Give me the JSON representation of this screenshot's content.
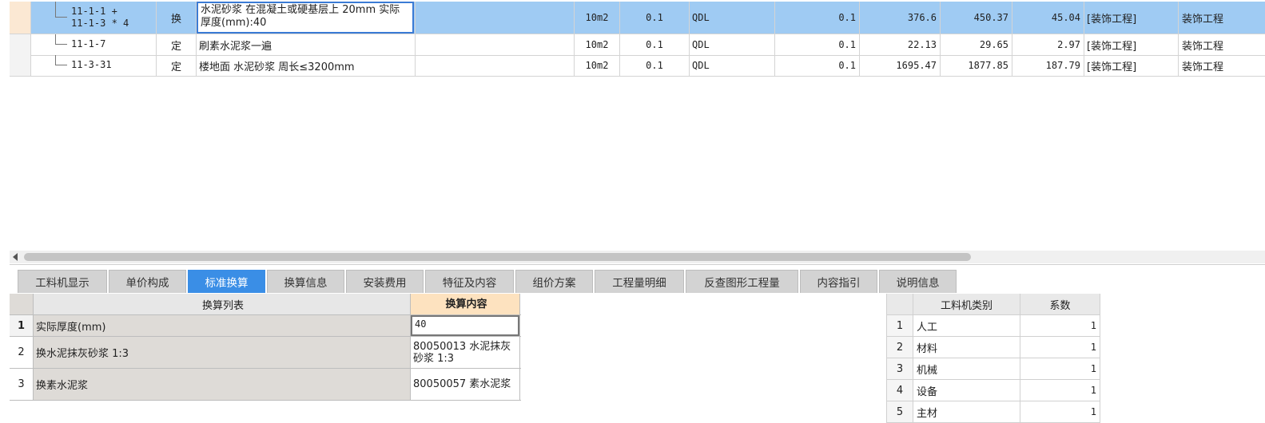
{
  "top_grid": {
    "rows": [
      {
        "code": "11-1-1 +\n11-1-3 * 4",
        "code_line1": "11-1-1 +",
        "code_line2": "11-1-3 * 4",
        "type": "换",
        "name": "水泥砂浆 在混凝土或硬基层上 20mm  实际厚度(mm):40",
        "spec": "",
        "unit": "10m2",
        "qty": "0.1",
        "expr": "QDL",
        "gcl": "0.1",
        "price1": "376.6",
        "price2": "450.37",
        "price3": "45.04",
        "category": "[装饰工程]",
        "specialty": "装饰工程",
        "selected": true
      },
      {
        "code": "11-1-7",
        "type": "定",
        "name": "刷素水泥浆一遍",
        "spec": "",
        "unit": "10m2",
        "qty": "0.1",
        "expr": "QDL",
        "gcl": "0.1",
        "price1": "22.13",
        "price2": "29.65",
        "price3": "2.97",
        "category": "[装饰工程]",
        "specialty": "装饰工程",
        "selected": false
      },
      {
        "code": "11-3-31",
        "type": "定",
        "name": "楼地面 水泥砂浆 周长≤3200mm",
        "spec": "",
        "unit": "10m2",
        "qty": "0.1",
        "expr": "QDL",
        "gcl": "0.1",
        "price1": "1695.47",
        "price2": "1877.85",
        "price3": "187.79",
        "category": "[装饰工程]",
        "specialty": "装饰工程",
        "selected": false
      }
    ]
  },
  "tabs": [
    {
      "label": "工料机显示",
      "active": false
    },
    {
      "label": "单价构成",
      "active": false
    },
    {
      "label": "标准换算",
      "active": true
    },
    {
      "label": "换算信息",
      "active": false
    },
    {
      "label": "安装费用",
      "active": false
    },
    {
      "label": "特征及内容",
      "active": false
    },
    {
      "label": "组价方案",
      "active": false
    },
    {
      "label": "工程量明细",
      "active": false
    },
    {
      "label": "反查图形工程量",
      "active": false
    },
    {
      "label": "内容指引",
      "active": false
    },
    {
      "label": "说明信息",
      "active": false
    }
  ],
  "conversion": {
    "header_list": "换算列表",
    "header_content": "换算内容",
    "rows": [
      {
        "index": "1",
        "name": "实际厚度(mm)",
        "value": "40"
      },
      {
        "index": "2",
        "name": "换水泥抹灰砂浆 1:3",
        "value": "80050013  水泥抹灰砂浆 1:3"
      },
      {
        "index": "3",
        "name": "换素水泥浆",
        "value": "80050057  素水泥浆"
      }
    ]
  },
  "coefficients": {
    "header_category": "工料机类别",
    "header_coef": "系数",
    "rows": [
      {
        "index": "1",
        "category": "人工",
        "coef": "1"
      },
      {
        "index": "2",
        "category": "材料",
        "coef": "1"
      },
      {
        "index": "3",
        "category": "机械",
        "coef": "1"
      },
      {
        "index": "4",
        "category": "设备",
        "coef": "1"
      },
      {
        "index": "5",
        "category": "主材",
        "coef": "1"
      }
    ]
  }
}
